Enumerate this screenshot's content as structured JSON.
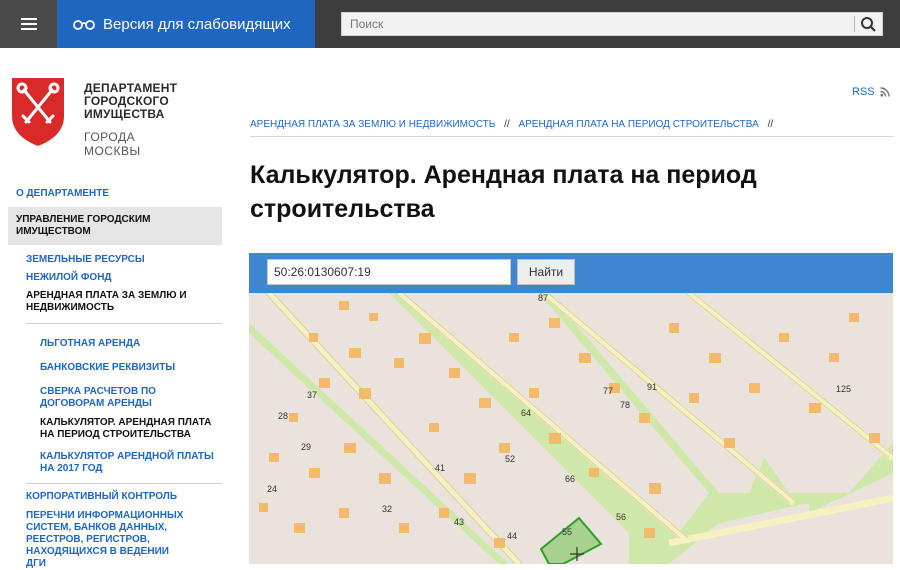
{
  "topbar": {
    "vision_label": "Версия для слабовидящих",
    "search_placeholder": "Поиск"
  },
  "logo": {
    "line1": "ДЕПАРТАМЕНТ",
    "line2": "ГОРОДСКОГО",
    "line3": "ИМУЩЕСТВА",
    "line4": "ГОРОДА МОСКВЫ"
  },
  "sidebar": {
    "about": "О ДЕПАРТАМЕНТЕ",
    "active_section": "УПРАВЛЕНИЕ ГОРОДСКИМ ИМУЩЕСТВОМ",
    "items": [
      "ЗЕМЕЛЬНЫЕ РЕСУРСЫ",
      "НЕЖИЛОЙ ФОНД",
      "АРЕНДНАЯ ПЛАТА ЗА ЗЕМЛЮ И НЕДВИЖИМОСТЬ"
    ],
    "subitems": [
      "ЛЬГОТНАЯ АРЕНДА",
      "БАНКОВСКИЕ РЕКВИЗИТЫ",
      "СВЕРКА РАСЧЕТОВ ПО ДОГОВОРАМ АРЕНДЫ",
      "КАЛЬКУЛЯТОР. АРЕНДНАЯ ПЛАТА НА ПЕРИОД СТРОИТЕЛЬСТВА",
      "КАЛЬКУЛЯТОР АРЕНДНОЙ ПЛАТЫ НА 2017 ГОД"
    ],
    "bottom": [
      "КОРПОРАТИВНЫЙ КОНТРОЛЬ",
      "ПЕРЕЧНИ ИНФОРМАЦИОННЫХ СИСТЕМ, БАНКОВ ДАННЫХ, РЕЕСТРОВ, РЕГИСТРОВ, НАХОДЯЩИХСЯ В ВЕДЕНИИ ДГИ"
    ]
  },
  "header": {
    "rss": "RSS"
  },
  "breadcrumb": {
    "items": [
      "АРЕНДНАЯ ПЛАТА ЗА ЗЕМЛЮ И НЕДВИЖИМОСТЬ",
      "АРЕНДНАЯ ПЛАТА НА ПЕРИОД СТРОИТЕЛЬСТВА"
    ],
    "separator": "//"
  },
  "main": {
    "title": "Калькулятор. Арендная плата на период строительства"
  },
  "map": {
    "cadastral_value": "50:26:0130607:19",
    "find_label": "Найти",
    "parcel_numbers": [
      "87",
      "37",
      "28",
      "29",
      "24",
      "32",
      "43",
      "44",
      "41",
      "52",
      "64",
      "66",
      "55",
      "56",
      "77",
      "78",
      "91",
      "125"
    ],
    "colors": {
      "grass": "#cfe7a8",
      "block": "#e9e3dc",
      "road": "#f7f1c2",
      "building": "#f2ba6a",
      "selected": "#2e9e28"
    }
  },
  "colors": {
    "topbar": "#3d3d3d",
    "accent": "#1f66c1",
    "map_bar": "#3f86d2"
  }
}
